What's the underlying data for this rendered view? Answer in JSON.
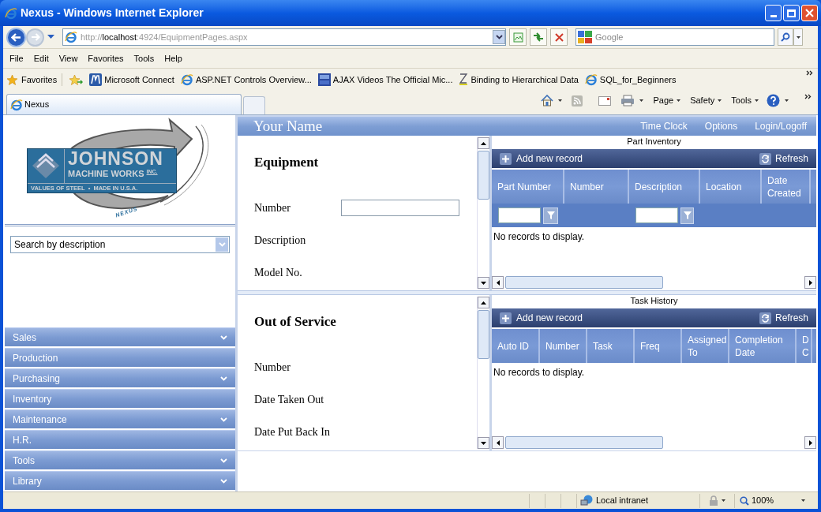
{
  "window": {
    "title": "Nexus - Windows Internet Explorer"
  },
  "address": {
    "scheme": "http://",
    "host": "localhost",
    "rest": ":4924/EquipmentPages.aspx"
  },
  "web_search": {
    "placeholder": "Google"
  },
  "menu": [
    "File",
    "Edit",
    "View",
    "Favorites",
    "Tools",
    "Help"
  ],
  "favorites_bar": {
    "label": "Favorites",
    "links": [
      {
        "label": "Microsoft Connect",
        "kind": "m"
      },
      {
        "label": "ASP.NET Controls Overview...",
        "kind": "ie"
      },
      {
        "label": "AJAX Videos The Official Mic...",
        "kind": "asp"
      },
      {
        "label": "Binding to Hierarchical Data",
        "kind": "x"
      },
      {
        "label": "SQL_for_Beginners",
        "kind": "ie"
      }
    ]
  },
  "tabs": [
    {
      "label": "Nexus",
      "selected": true
    }
  ],
  "command_bar": [
    "Page",
    "Safety",
    "Tools"
  ],
  "logo": {
    "name": "JOHNSON",
    "line2": "MACHINE WORKS",
    "suffix": "INC.",
    "tagline": "VALUES OF STEEL  •  MADE IN U.S.A.",
    "mark": "NEXUS"
  },
  "search_combo": {
    "value": "Search by description"
  },
  "nav": [
    {
      "label": "Sales",
      "expandable": true
    },
    {
      "label": "Production",
      "expandable": false
    },
    {
      "label": "Purchasing",
      "expandable": true
    },
    {
      "label": "Inventory",
      "expandable": false
    },
    {
      "label": "Maintenance",
      "expandable": true
    },
    {
      "label": "H.R.",
      "expandable": false
    },
    {
      "label": "Tools",
      "expandable": true
    },
    {
      "label": "Library",
      "expandable": true
    }
  ],
  "header": {
    "title": "Your Name",
    "links": [
      "Time Clock",
      "Options",
      "Login/Logoff"
    ]
  },
  "forms": [
    {
      "title": "Equipment",
      "fields": [
        {
          "label": "Number",
          "kind": "input"
        },
        {
          "label": "Description",
          "kind": "label"
        },
        {
          "label": "Model No.",
          "kind": "label"
        }
      ]
    },
    {
      "title": "Out of Service",
      "fields": [
        {
          "label": "Number",
          "kind": "label"
        },
        {
          "label": "Date Taken Out",
          "kind": "label"
        },
        {
          "label": "Date Put Back In",
          "kind": "label"
        }
      ]
    }
  ],
  "grids": [
    {
      "title": "Part Inventory",
      "add": "Add new record",
      "refresh": "Refresh",
      "empty": "No records to display.",
      "columns": [
        {
          "label": "Part Number",
          "filter": true
        },
        {
          "label": "Number",
          "filter": false
        },
        {
          "label": "Description",
          "filter": true
        },
        {
          "label": "Location",
          "filter": false
        },
        {
          "label": "Date Created",
          "filter": false
        }
      ]
    },
    {
      "title": "Task History",
      "add": "Add new record",
      "refresh": "Refresh",
      "empty": "No records to display.",
      "columns": [
        {
          "label": "Auto ID",
          "filter": false
        },
        {
          "label": "Number",
          "filter": false
        },
        {
          "label": "Task",
          "filter": false
        },
        {
          "label": "Freq",
          "filter": false
        },
        {
          "label": "Assigned To",
          "filter": false
        },
        {
          "label": "Completion Date",
          "filter": false
        },
        {
          "label": "D C",
          "filter": false
        }
      ]
    }
  ],
  "status_bar": {
    "zone": "Local intranet",
    "zoom": "100%"
  }
}
